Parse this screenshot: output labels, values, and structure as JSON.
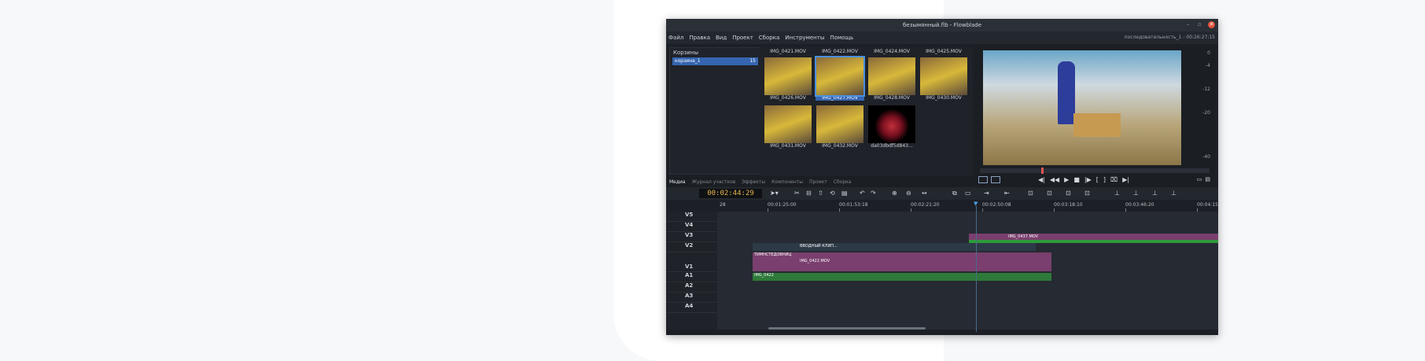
{
  "window": {
    "title": "безымянный.flb - Flowblade",
    "controls": [
      "–",
      "▫",
      "✕"
    ]
  },
  "menu": [
    "Файл",
    "Правка",
    "Вид",
    "Проект",
    "Сборка",
    "Инструменты",
    "Помощь"
  ],
  "sequence_info": "последовательность_1 - 00:26:27:15",
  "bins": {
    "title": "Корзины",
    "items": [
      {
        "label": "корзина_1",
        "count": "15"
      }
    ]
  },
  "media": {
    "clips": [
      {
        "name": "IMG_0421.MOV"
      },
      {
        "name": "IMG_0422.MOV"
      },
      {
        "name": "IMG_0424.MOV"
      },
      {
        "name": "IMG_0425.MOV"
      },
      {
        "name": "IMG_0426.MOV"
      },
      {
        "name": "IMG_0427.MOV"
      },
      {
        "name": "IMG_0428.MOV"
      },
      {
        "name": "IMG_0430.MOV"
      },
      {
        "name": "IMG_0431.MOV"
      },
      {
        "name": "IMG_0432.MOV"
      },
      {
        "name": "da03dbdf5d843..."
      }
    ],
    "selected_clip": "IMG_0427.MOV"
  },
  "tabs": [
    "Медиа",
    "Журнал участков",
    "Эффекты",
    "Компоненты",
    "Проект",
    "Сборка"
  ],
  "timecode": "00:02:44:29",
  "ruler": [
    "28",
    "00:01:25:00",
    "00:01:53:18",
    "00:02:21:20",
    "00:02:50:08",
    "00:03:18:10",
    "00:03:46:20",
    "00:04:15"
  ],
  "tracks": [
    "V5",
    "V4",
    "V3",
    "V2",
    "V1",
    "A1",
    "A2",
    "A3",
    "A4"
  ],
  "timeline_clips": {
    "v3": "IMG_0437.MOV",
    "v2": "ВВОДНЫЙ КЛИП...",
    "v1_title": "ТИМНСТЕДОВНИЦ",
    "v1": "IMG_0422.MOV",
    "a1": "IMG_0422"
  },
  "vu_scale": [
    "0",
    "-4",
    "-12",
    "-20",
    "-40"
  ],
  "colors": {
    "accent": "#3565b0",
    "timecode": "#e9b64c",
    "video_clip": "#7a3f6e",
    "audio_clip": "#2e7a3a"
  }
}
